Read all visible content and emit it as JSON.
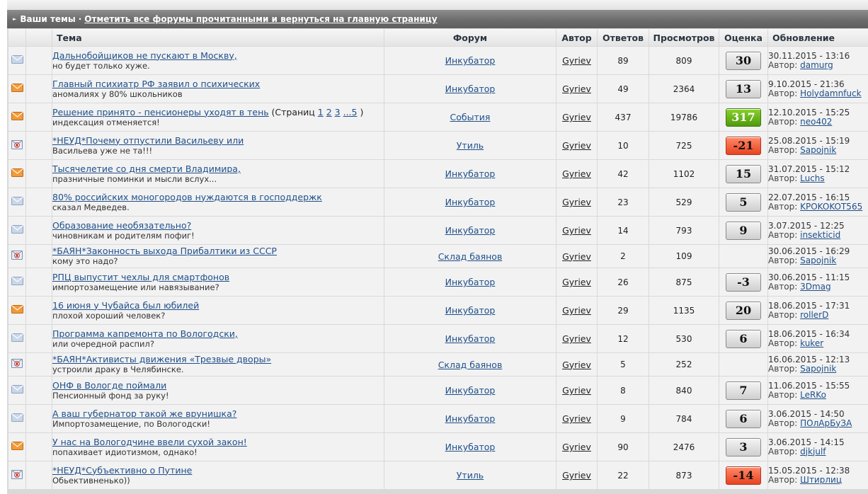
{
  "header": {
    "title": "Ваши темы",
    "separator": "·",
    "mark_read_link": "Отметить все форумы прочитанными и вернуться на главную страницу"
  },
  "columns": {
    "topic": "Тема",
    "forum": "Форум",
    "author": "Автор",
    "replies": "Ответов",
    "views": "Просмотров",
    "rating": "Оценка",
    "updated": "Обновление"
  },
  "updated_by_label": "Автор:",
  "rows": [
    {
      "icon": "envelope-read-icon",
      "title": "Дальнобойщиков не пускают в Москву,",
      "pages_prefix": "",
      "pages": [],
      "pages_suffix": "",
      "desc": "но будет только хуже.",
      "forum": "Инкубатор",
      "author": "Gyriev",
      "replies": "89",
      "views": "809",
      "rating": "30",
      "rating_style": "neutral",
      "updated_date": "30.11.2015 - 13:16",
      "updated_by": "damurg"
    },
    {
      "icon": "envelope-hot-icon",
      "title": "Главный психиатр РФ заявил о психических",
      "pages_prefix": "",
      "pages": [],
      "pages_suffix": "",
      "desc": "аномалиях у 80% школьников",
      "forum": "Инкубатор",
      "author": "Gyriev",
      "replies": "49",
      "views": "2364",
      "rating": "13",
      "rating_style": "neutral",
      "updated_date": "9.10.2015 - 21:36",
      "updated_by": "Holydamnfuck"
    },
    {
      "icon": "envelope-hot-icon",
      "title": "Решение принято - пенсионеры уходят в тень",
      "pages_prefix": "(Страниц",
      "pages": [
        "1",
        "2",
        "3",
        "...5"
      ],
      "pages_suffix": ")",
      "desc": "индексация отменяется!",
      "forum": "События",
      "author": "Gyriev",
      "replies": "437",
      "views": "19786",
      "rating": "317",
      "rating_style": "pos-high",
      "updated_date": "12.10.2015 - 15:25",
      "updated_by": "neo402"
    },
    {
      "icon": "envelope-poll-icon",
      "title": "*НЕУД*Почему отпустили Васильеву или",
      "pages_prefix": "",
      "pages": [],
      "pages_suffix": "",
      "desc": "Васильева уже не та!!!",
      "forum": "Утиль",
      "author": "Gyriev",
      "replies": "10",
      "views": "725",
      "rating": "-21",
      "rating_style": "neg-high",
      "updated_date": "25.08.2015 - 15:19",
      "updated_by": "Sapojnik"
    },
    {
      "icon": "envelope-hot-icon",
      "title": "Тысячелетие со дня смерти Владимира,",
      "pages_prefix": "",
      "pages": [],
      "pages_suffix": "",
      "desc": "празничные поминки и мысли вслух...",
      "forum": "Инкубатор",
      "author": "Gyriev",
      "replies": "42",
      "views": "1102",
      "rating": "15",
      "rating_style": "neutral",
      "updated_date": "31.07.2015 - 15:12",
      "updated_by": "Luchs"
    },
    {
      "icon": "envelope-read-icon",
      "title": "80% российских моногородов нуждаются в господдержк",
      "pages_prefix": "",
      "pages": [],
      "pages_suffix": "",
      "desc": "сказал Медведев.",
      "forum": "Инкубатор",
      "author": "Gyriev",
      "replies": "23",
      "views": "529",
      "rating": "5",
      "rating_style": "neutral",
      "updated_date": "22.07.2015 - 16:15",
      "updated_by": "KPOKOKOT565"
    },
    {
      "icon": "envelope-read-icon",
      "title": "Образование необязательно?",
      "pages_prefix": "",
      "pages": [],
      "pages_suffix": "",
      "desc": "чиновникам и родителям пофиг!",
      "forum": "Инкубатор",
      "author": "Gyriev",
      "replies": "14",
      "views": "793",
      "rating": "9",
      "rating_style": "neutral",
      "updated_date": "3.07.2015 - 12:25",
      "updated_by": "insekticid"
    },
    {
      "icon": "envelope-poll-icon",
      "title": "*БАЯН*Законность выхода Прибалтики из СССР",
      "pages_prefix": "",
      "pages": [],
      "pages_suffix": "",
      "desc": "кому это надо?",
      "forum": "Склад баянов",
      "author": "Gyriev",
      "replies": "2",
      "views": "109",
      "rating": "",
      "rating_style": "none",
      "updated_date": "30.06.2015 - 16:29",
      "updated_by": "Sapojnik"
    },
    {
      "icon": "envelope-read-icon",
      "title": "РПЦ выпустит чехлы для смартфонов",
      "pages_prefix": "",
      "pages": [],
      "pages_suffix": "",
      "desc": "импортозамещение или навязывание?",
      "forum": "Инкубатор",
      "author": "Gyriev",
      "replies": "26",
      "views": "875",
      "rating": "-3",
      "rating_style": "neutral",
      "updated_date": "30.06.2015 - 11:15",
      "updated_by": "3Dmag"
    },
    {
      "icon": "envelope-hot-icon",
      "title": "16 июня у Чубайса был юбилей",
      "pages_prefix": "",
      "pages": [],
      "pages_suffix": "",
      "desc": "плохой хороший человек?",
      "forum": "Инкубатор",
      "author": "Gyriev",
      "replies": "29",
      "views": "1135",
      "rating": "20",
      "rating_style": "neutral",
      "updated_date": "18.06.2015 - 17:31",
      "updated_by": "rollerD"
    },
    {
      "icon": "envelope-read-icon",
      "title": "Программа капремонта по Вологодски,",
      "pages_prefix": "",
      "pages": [],
      "pages_suffix": "",
      "desc": "или очередной распил?",
      "forum": "Инкубатор",
      "author": "Gyriev",
      "replies": "12",
      "views": "530",
      "rating": "6",
      "rating_style": "neutral",
      "updated_date": "18.06.2015 - 16:34",
      "updated_by": "kuker"
    },
    {
      "icon": "envelope-poll-icon",
      "title": "*БАЯН*Активисты движения «Трезвые дворы»",
      "pages_prefix": "",
      "pages": [],
      "pages_suffix": "",
      "desc": "устроили драку в Челябинске.",
      "forum": "Склад баянов",
      "author": "Gyriev",
      "replies": "5",
      "views": "252",
      "rating": "",
      "rating_style": "none",
      "updated_date": "16.06.2015 - 12:13",
      "updated_by": "Sapojnik"
    },
    {
      "icon": "envelope-read-icon",
      "title": "ОНФ в Вологде поймали",
      "pages_prefix": "",
      "pages": [],
      "pages_suffix": "",
      "desc": "Пенсионный фонд за руку!",
      "forum": "Инкубатор",
      "author": "Gyriev",
      "replies": "8",
      "views": "840",
      "rating": "7",
      "rating_style": "neutral",
      "updated_date": "11.06.2015 - 15:55",
      "updated_by": "LeRKo"
    },
    {
      "icon": "envelope-read-icon",
      "title": "А ваш губернатор такой же врунишка?",
      "pages_prefix": "",
      "pages": [],
      "pages_suffix": "",
      "desc": "Импортозамещение, по Вологодски!",
      "forum": "Инкубатор",
      "author": "Gyriev",
      "replies": "9",
      "views": "784",
      "rating": "6",
      "rating_style": "neutral",
      "updated_date": "3.06.2015 - 14:50",
      "updated_by": "ПОлАрБуЗА"
    },
    {
      "icon": "envelope-hot-icon",
      "title": "У нас на Вологодчине ввели сухой закон!",
      "pages_prefix": "",
      "pages": [],
      "pages_suffix": "",
      "desc": "попахивает идиотизмом, однако!",
      "forum": "Инкубатор",
      "author": "Gyriev",
      "replies": "90",
      "views": "2476",
      "rating": "3",
      "rating_style": "neutral",
      "updated_date": "3.06.2015 - 14:15",
      "updated_by": "djkjulf"
    },
    {
      "icon": "envelope-poll-icon",
      "title": "*НЕУД*Субъективно о Путине",
      "pages_prefix": "",
      "pages": [],
      "pages_suffix": "",
      "desc": "Обьективненько))",
      "forum": "Утиль",
      "author": "Gyriev",
      "replies": "22",
      "views": "873",
      "rating": "-14",
      "rating_style": "neg-high",
      "updated_date": "15.05.2015 - 12:38",
      "updated_by": "Штирлиц"
    }
  ],
  "colors": {
    "link": "#1f4f8a",
    "header_bar": "#6a6a6a",
    "row_bg": "#f2f2f2",
    "rating_positive": "#5aab14",
    "rating_negative": "#e8431f"
  }
}
